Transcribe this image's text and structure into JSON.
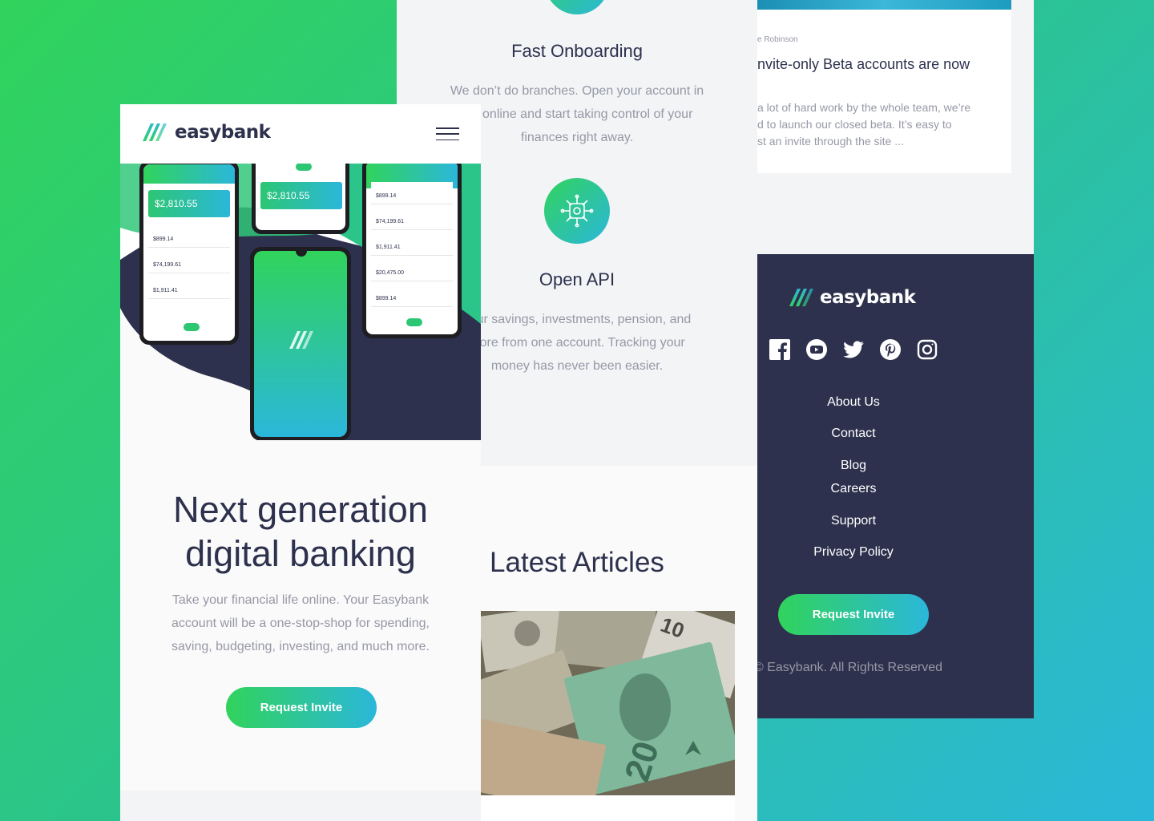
{
  "brand": {
    "name": "easybank"
  },
  "left": {
    "nav": {
      "logo_text": "easybank",
      "menu_label": "menu"
    },
    "hero": {
      "phone_balances": [
        "$2,810.55",
        "$2,810.55"
      ],
      "left_phone_rows": [
        "$899.14",
        "$74,199.61",
        "$1,911.41"
      ],
      "right_phone_rows": [
        "$899.14",
        "$74,199.61",
        "$1,911.41",
        "$20,475.00",
        "$899.14"
      ]
    },
    "headline": "Next generation digital banking",
    "lead": "Take your financial life online. Your Easybank account will be a one-stop-shop for spending, saving, budgeting, investing, and much more.",
    "cta": "Request Invite"
  },
  "middle": {
    "feature1": {
      "title": "Fast Onboarding",
      "text_lines": [
        "We don’t do branches. Open your account in",
        "s online and start taking control of your",
        "finances right away."
      ]
    },
    "feature2": {
      "title": "Open API",
      "text_lines": [
        "your savings, investments, pension, and",
        "more from one account. Tracking your",
        "money has never been easier."
      ]
    },
    "articles_title": "Latest Articles"
  },
  "right": {
    "article": {
      "author": "e Robinson",
      "title": "nvite-only Beta accounts are now",
      "text_lines": [
        "a lot of hard work by the whole team, we’re",
        "d to launch our closed beta. It’s easy to",
        "st an invite through the site ..."
      ]
    },
    "footer": {
      "logo_text": "easybank",
      "social": [
        "facebook-icon",
        "youtube-icon",
        "twitter-icon",
        "pinterest-icon",
        "instagram-icon"
      ],
      "links": [
        "About Us",
        "Contact",
        "Blog",
        "Careers",
        "Support",
        "Privacy Policy"
      ],
      "cta": "Request Invite",
      "copyright": "© Easybank. All Rights Reserved"
    }
  },
  "colors": {
    "dark_blue": "#2d314d",
    "lime_green": "#31d35c",
    "bright_cyan": "#2bb7da",
    "grayish_blue": "#9698a6"
  }
}
